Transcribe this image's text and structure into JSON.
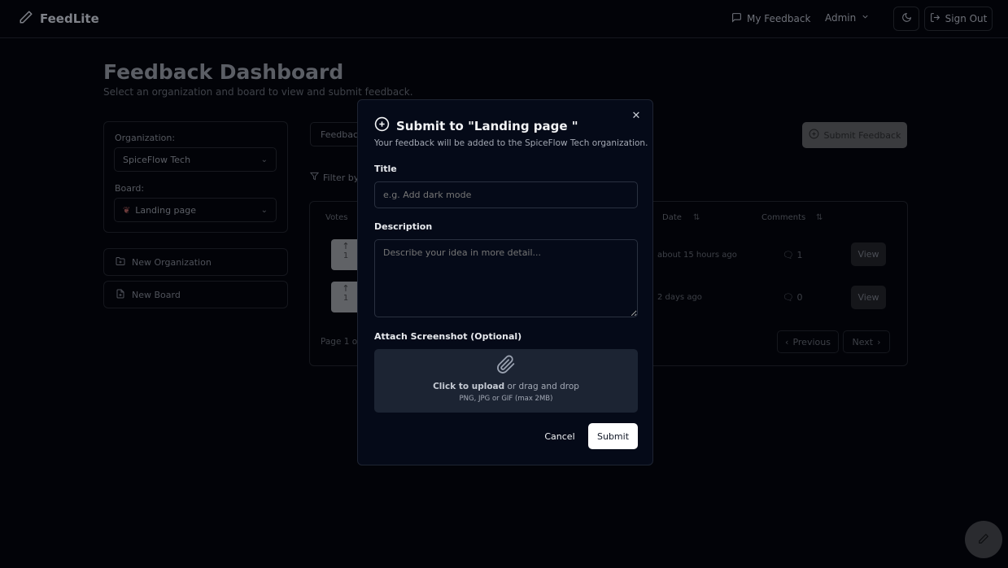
{
  "header": {
    "logo_text": "FeedLite",
    "my_feedback": "My Feedback",
    "admin": "Admin",
    "sign_out": "Sign Out"
  },
  "page": {
    "title": "Feedback Dashboard",
    "subtitle": "Select an organization and board to view and submit feedback."
  },
  "sidebar": {
    "org_label": "Organization:",
    "org_value": "SpiceFlow Tech",
    "board_label": "Board:",
    "board_value": "Landing page",
    "new_org": "New Organization",
    "new_board": "New Board"
  },
  "main": {
    "tab_partial": "Feedback",
    "filter_partial": "Filter by",
    "submit_feedback": "Submit Feedback",
    "columns": {
      "votes": "Votes",
      "date": "Date",
      "comments": "Comments"
    },
    "rows": [
      {
        "votes": "1",
        "date": "about 15 hours ago",
        "comments": "1",
        "action": "View"
      },
      {
        "votes": "1",
        "date": "2 days ago",
        "comments": "0",
        "action": "View"
      }
    ],
    "page_partial": "Page 1 of",
    "previous": "Previous",
    "next": "Next"
  },
  "modal": {
    "title": "Submit to \"Landing page \"",
    "subtitle": "Your feedback will be added to the SpiceFlow Tech organization.",
    "title_label": "Title",
    "title_placeholder": "e.g. Add dark mode",
    "description_label": "Description",
    "description_placeholder": "Describe your idea in more detail...",
    "attach_label": "Attach Screenshot (Optional)",
    "upload_strong": "Click to upload",
    "upload_rest": " or drag and drop",
    "upload_hint": "PNG, JPG or GIF (max 2MB)",
    "cancel": "Cancel",
    "submit": "Submit"
  }
}
